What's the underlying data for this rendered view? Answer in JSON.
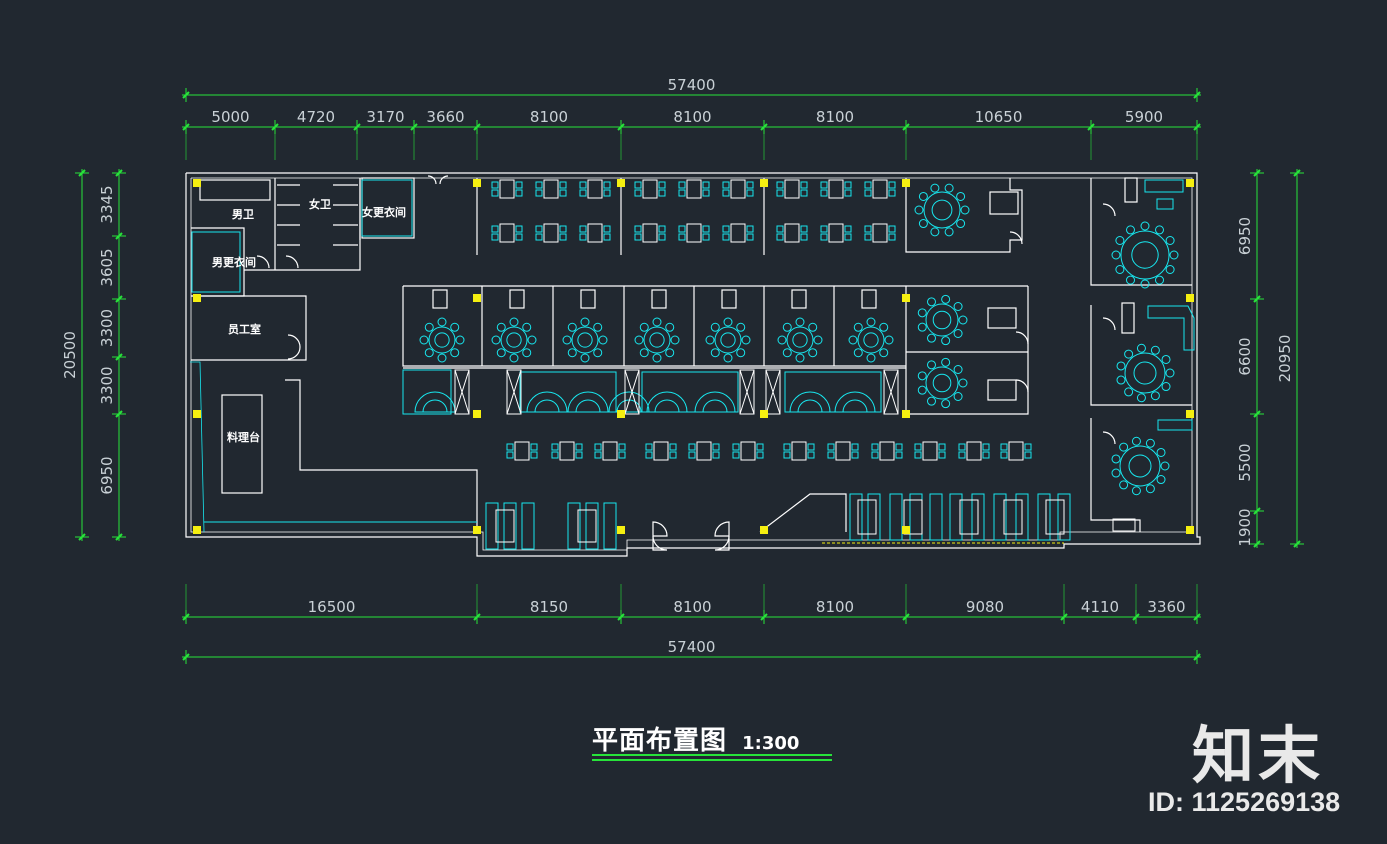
{
  "drawing": {
    "title": "平面布置图",
    "scale": "1:300",
    "brand": "知末",
    "asset_id": "ID: 1125269138"
  },
  "dimensions": {
    "top_total": "57400",
    "top": [
      "5000",
      "4720",
      "3170",
      "3660",
      "8100",
      "8100",
      "8100",
      "10650",
      "5900"
    ],
    "bottom": [
      "16500",
      "8150",
      "8100",
      "8100",
      "9080",
      "4110",
      "3360"
    ],
    "bottom_total": "57400",
    "left_total": "20500",
    "left": [
      "3345",
      "3605",
      "3300",
      "3300",
      "6950"
    ],
    "right": [
      "6950",
      "6600",
      "5500",
      "1900"
    ],
    "right_total": "20950"
  },
  "rooms": {
    "mens_wc": "男卫",
    "womens_wc": "女卫",
    "womens_locker": "女更衣间",
    "mens_locker": "男更衣间",
    "staff_room": "员工室",
    "prep_counter": "料理台"
  },
  "colors": {
    "background": "#212830",
    "wall": "#ffffff",
    "furniture": "#18e6ee",
    "dimension": "#27e33a",
    "column": "#f5ef10"
  }
}
